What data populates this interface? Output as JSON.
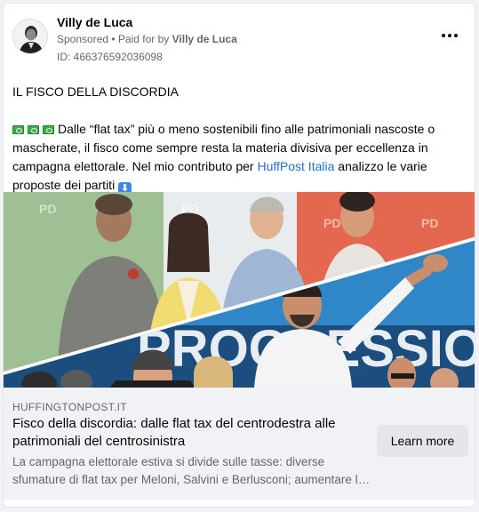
{
  "post": {
    "author": "Villy de Luca",
    "sponsored_label": "Sponsored",
    "paid_for_prefix": " • Paid for by ",
    "paid_for_name": "Villy de Luca",
    "ad_id": "ID: 466376592036098",
    "more_icon": "more-horizontal-icon"
  },
  "body": {
    "title": "IL FISCO DELLA DISCORDIA",
    "paragraph_part1": "Dalle “flat tax” più o meno sostenibili fino alle patrimoniali nascoste o mascherate, il fisco come sempre resta la materia divisiva per eccellenza in campagna elettorale. Nel mio contributo per ",
    "link_text": "HuffPost Italia",
    "paragraph_part2": " analizzo le varie proposte dei partiti ",
    "arrow_glyph": "⬇",
    "link_color": "#216fdb"
  },
  "media": {
    "banner_text_top": "PD",
    "banner_text_bottom": "PROGRESSIO"
  },
  "footer": {
    "domain": "HUFFINGTONPOST.IT",
    "title": "Fisco della discordia: dalle flat tax del centrodestra alle patrimoniali del centrosinistra",
    "description": "La campagna elettorale estiva si divide sulle tasse: diverse sfumature di flat tax per Meloni, Salvini e Berlusconi; aumentare la pressione fiscale sui patrimoni per il centrosinistra",
    "cta": "Learn more"
  }
}
